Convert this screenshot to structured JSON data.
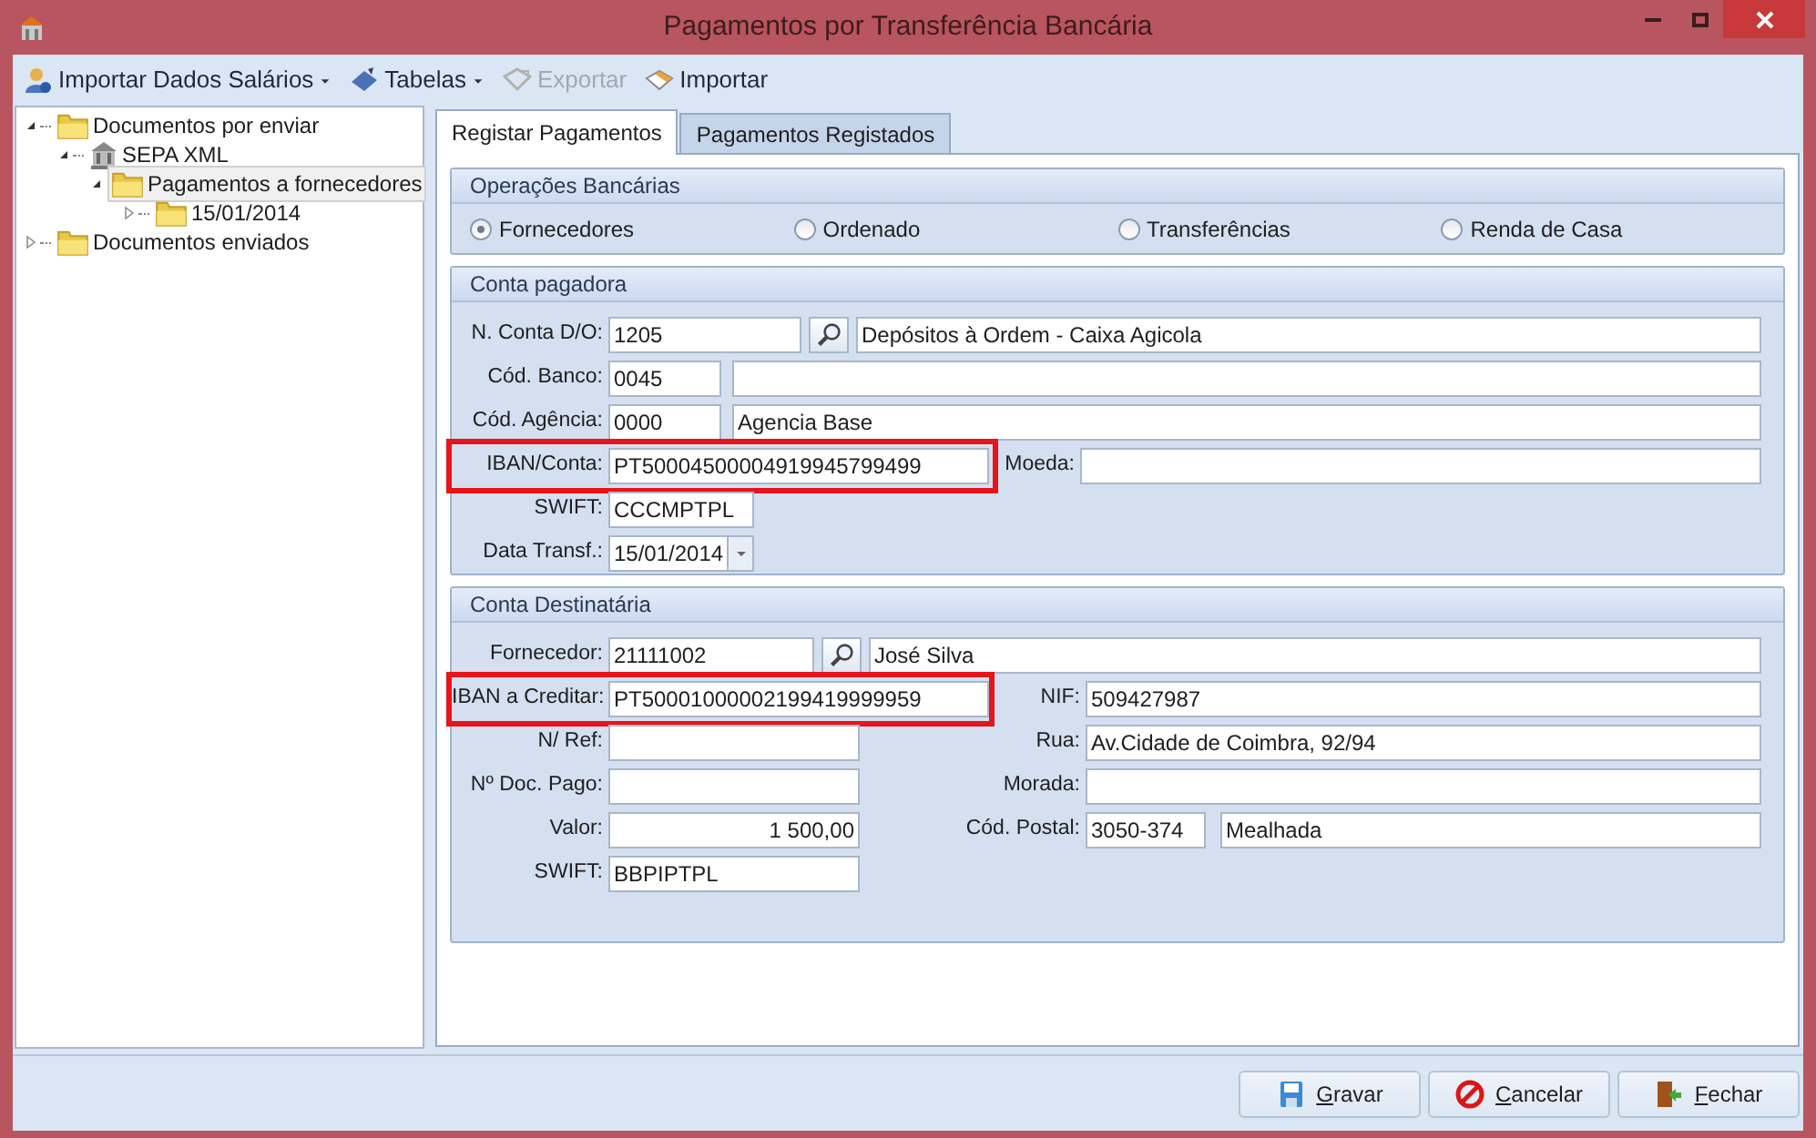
{
  "window": {
    "title": "Pagamentos por Transferência Bancária"
  },
  "toolbar": [
    {
      "label": "Importar Dados Salários",
      "kind": "people",
      "dropdown": true,
      "disabled": false
    },
    {
      "label": "Tabelas",
      "kind": "table",
      "dropdown": true,
      "disabled": false
    },
    {
      "label": "Exportar",
      "kind": "export",
      "dropdown": false,
      "disabled": true
    },
    {
      "label": "Importar",
      "kind": "import",
      "dropdown": false,
      "disabled": false
    }
  ],
  "tree": [
    {
      "label": "Documentos por enviar",
      "kind": "folder",
      "expanded": true,
      "selected": false,
      "children": [
        {
          "label": "SEPA XML",
          "kind": "bank",
          "expanded": true,
          "selected": false,
          "children": [
            {
              "label": "Pagamentos a fornecedores",
              "kind": "folder",
              "expanded": true,
              "selected": true,
              "children": [
                {
                  "label": "15/01/2014",
                  "kind": "folder",
                  "expanded": false,
                  "selected": false
                }
              ]
            }
          ]
        }
      ]
    },
    {
      "label": "Documentos enviados",
      "kind": "folder",
      "expanded": false,
      "selected": false
    }
  ],
  "tabs": [
    {
      "label": "Registar Pagamentos",
      "selected": true
    },
    {
      "label": "Pagamentos Registados",
      "selected": false
    }
  ],
  "operations": {
    "title": "Operações Bancárias",
    "options": [
      {
        "label": "Fornecedores",
        "selected": true
      },
      {
        "label": "Ordenado",
        "selected": false
      },
      {
        "label": "Transferências",
        "selected": false
      },
      {
        "label": "Renda de Casa",
        "selected": false
      }
    ]
  },
  "payer": {
    "title": "Conta pagadora",
    "fields": [
      {
        "kind": "lookup",
        "label": "N. Conta D/O:",
        "value": "1205",
        "description": "Depósitos à Ordem - Caixa Agicola",
        "highlighted": false
      },
      {
        "kind": "code",
        "label": "Cód. Banco:",
        "value": "0045",
        "highlighted": false
      },
      {
        "kind": "code",
        "label": "Cód. Agência:",
        "value": "0000",
        "description": "Agencia Base",
        "highlighted": false
      },
      {
        "kind": "iban",
        "label": "IBAN/Conta:",
        "value": "PT50004500004919945799499",
        "extra_label": "Moeda:",
        "highlighted": true
      },
      {
        "kind": "short",
        "label": "SWIFT:",
        "value": "CCCMPTPL",
        "highlighted": false
      },
      {
        "kind": "date",
        "label": "Data Transf.:",
        "value": "15/01/2014",
        "highlighted": false
      }
    ]
  },
  "recipient": {
    "title": "Conta Destinatária",
    "supplier": {
      "label": "Fornecedor:",
      "value": "21111002",
      "description": "José Silva"
    },
    "rows": [
      {
        "left": {
          "kind": "iban",
          "label": "IBAN a Creditar:",
          "value": "PT50001000002199419999959",
          "highlighted": true
        },
        "right": {
          "kind": "text",
          "label": "NIF:",
          "value": "509427987"
        }
      },
      {
        "left": {
          "kind": "text",
          "label": "N/ Ref:",
          "highlighted": false
        },
        "right": {
          "kind": "text",
          "label": "Rua:",
          "value": "Av.Cidade de Coimbra, 92/94"
        }
      },
      {
        "left": {
          "kind": "text",
          "label": "Nº Doc. Pago:",
          "highlighted": false
        },
        "right": {
          "kind": "text",
          "label": "Morada:"
        }
      },
      {
        "left": {
          "kind": "amount",
          "label": "Valor:",
          "value": "1 500,00",
          "highlighted": false
        },
        "right": {
          "kind": "postal",
          "label": "Cód. Postal:",
          "value": "3050-374",
          "city": "Mealhada"
        }
      },
      {
        "left": {
          "kind": "text",
          "label": "SWIFT:",
          "value": "BBPIPTPL",
          "highlighted": false
        }
      }
    ]
  },
  "buttons": [
    {
      "label": "Gravar",
      "kind": "save"
    },
    {
      "label": "Cancelar",
      "kind": "cancel"
    },
    {
      "label": "Fechar",
      "kind": "close"
    }
  ]
}
